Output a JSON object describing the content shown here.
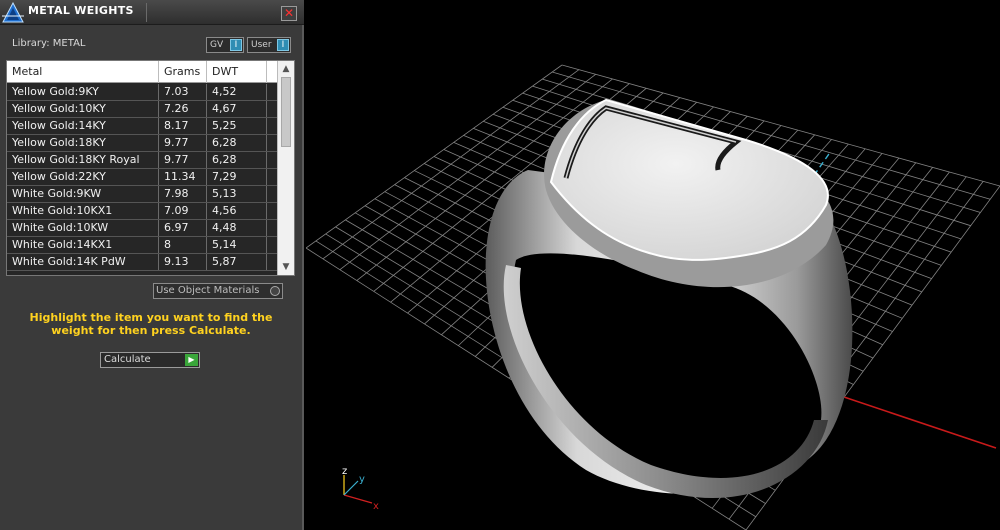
{
  "panel": {
    "title": "METAL WEIGHTS",
    "close_label": "✕",
    "library_label": "Library: METAL",
    "gv_label": "GV",
    "user_label": "User",
    "toggle_glyph": "I",
    "columns": [
      "Metal",
      "Grams",
      "DWT"
    ],
    "rows": [
      {
        "metal": "Yellow Gold:9KY",
        "grams": "7.03",
        "dwt": "4,52"
      },
      {
        "metal": "Yellow Gold:10KY",
        "grams": "7.26",
        "dwt": "4,67"
      },
      {
        "metal": "Yellow Gold:14KY",
        "grams": "8.17",
        "dwt": "5,25"
      },
      {
        "metal": "Yellow Gold:18KY",
        "grams": "9.77",
        "dwt": "6,28"
      },
      {
        "metal": "Yellow Gold:18KY Royal",
        "grams": "9.77",
        "dwt": "6,28"
      },
      {
        "metal": "Yellow Gold:22KY",
        "grams": "11.34",
        "dwt": "7,29"
      },
      {
        "metal": "White Gold:9KW",
        "grams": "7.98",
        "dwt": "5,13"
      },
      {
        "metal": "White Gold:10KX1",
        "grams": "7.09",
        "dwt": "4,56"
      },
      {
        "metal": "White Gold:10KW",
        "grams": "6.97",
        "dwt": "4,48"
      },
      {
        "metal": "White Gold:14KX1",
        "grams": "8",
        "dwt": "5,14"
      },
      {
        "metal": "White Gold:14K PdW",
        "grams": "9.13",
        "dwt": "5,87"
      }
    ],
    "use_object_materials": "Use Object Materials",
    "hint": "Highlight the item you want to find the weight for then press Calculate.",
    "calculate_label": "Calculate"
  },
  "viewport": {
    "axis_labels": {
      "x": "x",
      "y": "y",
      "z": "z"
    },
    "colors": {
      "background": "#000000",
      "grid": "#9a9a9a",
      "x_axis": "#c81a1a",
      "y_axis": "#3ab0d0",
      "ring": "#d9d9d9"
    }
  },
  "colors": {
    "panel_bg": "#3a3a3a",
    "hint_text": "#ffd21f",
    "toggle_accent": "#2f8db3"
  }
}
